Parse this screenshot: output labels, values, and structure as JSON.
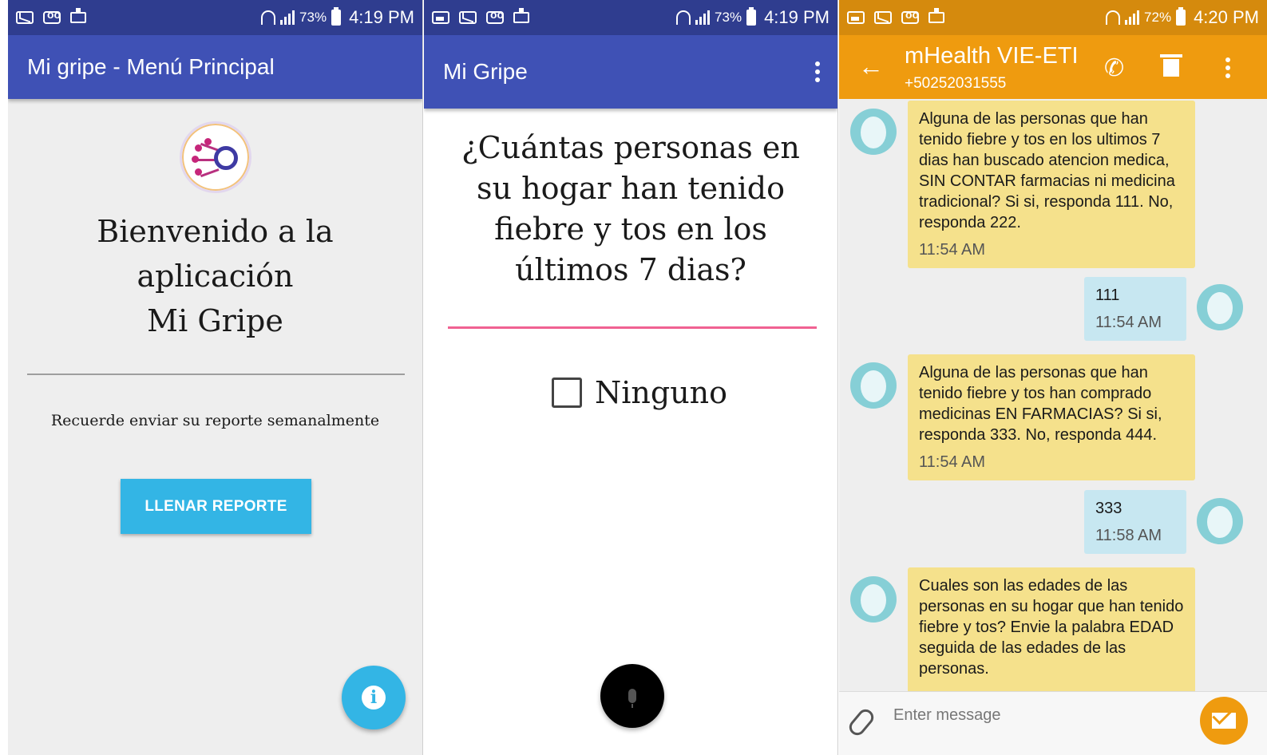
{
  "screen1": {
    "status": {
      "battery": "73%",
      "time": "4:19 PM"
    },
    "app_title": "Mi gripe - Menú Principal",
    "welcome_lines": [
      "Bienvenido a la",
      "aplicación",
      "Mi Gripe"
    ],
    "reminder": "Recuerde enviar su reporte semanalmente",
    "fill_button": "LLENAR REPORTE"
  },
  "screen2": {
    "status": {
      "battery": "73%",
      "time": "4:19 PM"
    },
    "app_title": "Mi Gripe",
    "question": "¿Cuántas personas en su hogar han tenido fiebre y tos en los últimos 7 dias?",
    "answer_value": "",
    "checkbox_label": "Ninguno"
  },
  "screen3": {
    "status": {
      "battery": "72%",
      "time": "4:20 PM"
    },
    "contact_name": "mHealth VIE-ETI",
    "contact_number": "+50252031555",
    "messages": [
      {
        "direction": "in",
        "text": "Alguna de las personas que han tenido fiebre y tos en los ultimos 7 dias han buscado atencion medica, SIN CONTAR farmacias ni medicina tradicional? Si si, responda 111. No, responda 222.",
        "time": "11:54 AM"
      },
      {
        "direction": "out",
        "text": "111",
        "time": "11:54 AM"
      },
      {
        "direction": "in",
        "text": "Alguna de las personas que han tenido fiebre y tos han comprado medicinas EN FARMACIAS? Si si, responda 333. No, responda 444.",
        "time": "11:54 AM"
      },
      {
        "direction": "out",
        "text": "333",
        "time": "11:58 AM"
      },
      {
        "direction": "in",
        "text": "Cuales son las edades de las personas en su hogar que han tenido fiebre y tos? Envie la palabra EDAD seguida de las edades de las personas.",
        "time": ""
      }
    ],
    "composer_placeholder": "Enter message"
  },
  "colors": {
    "primary_blue": "#3f51b5",
    "accent_light_blue": "#33b5e5",
    "sms_orange": "#ef9b0f",
    "incoming_bubble": "#f5e18c",
    "outgoing_bubble": "#c7e7f1",
    "input_underline_pink": "#f06292"
  },
  "icons": [
    "mail-icon",
    "voicemail-icon",
    "camera-icon",
    "wifi-icon",
    "signal-icon",
    "battery-icon",
    "info-icon",
    "mic-icon",
    "more-vert-icon",
    "back-arrow-icon",
    "phone-icon",
    "trash-icon",
    "attach-icon",
    "send-icon"
  ]
}
